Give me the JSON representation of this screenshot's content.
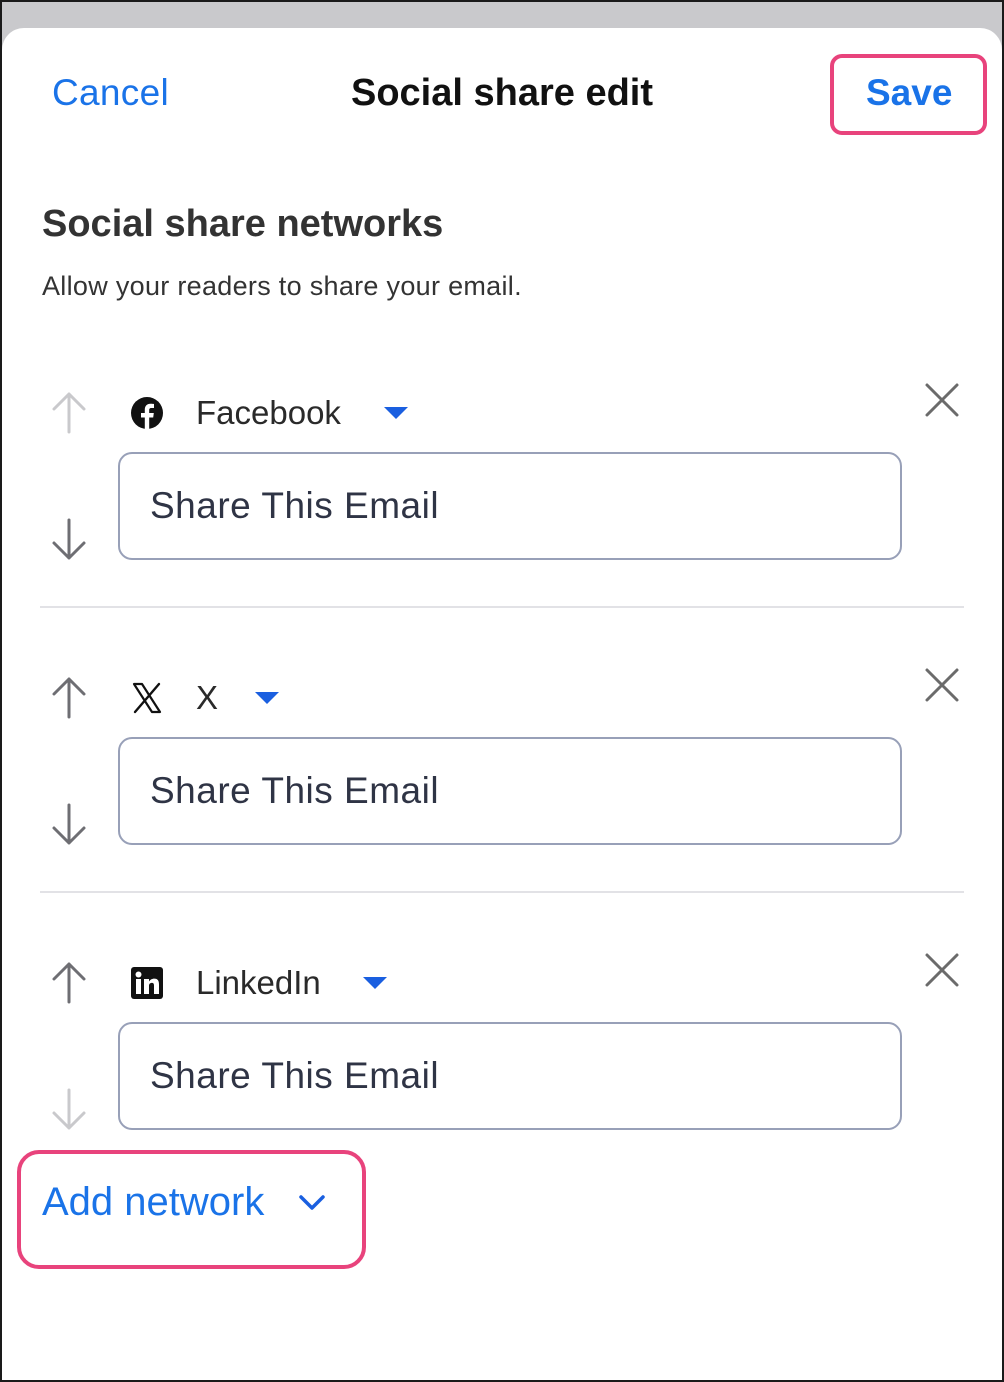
{
  "header": {
    "cancel_label": "Cancel",
    "title": "Social share edit",
    "save_label": "Save"
  },
  "section": {
    "title": "Social share networks",
    "description": "Allow your readers to share your email."
  },
  "networks": [
    {
      "name": "Facebook",
      "icon": "facebook-icon",
      "share_text": "Share This Email",
      "up_enabled": false,
      "down_enabled": true
    },
    {
      "name": "X",
      "icon": "x-icon",
      "share_text": "Share This Email",
      "up_enabled": true,
      "down_enabled": true
    },
    {
      "name": "LinkedIn",
      "icon": "linkedin-icon",
      "share_text": "Share This Email",
      "up_enabled": true,
      "down_enabled": false
    }
  ],
  "add_network_label": "Add network",
  "colors": {
    "accent": "#1a73e8",
    "highlight": "#e8437c",
    "input_border": "#98a0b8"
  }
}
